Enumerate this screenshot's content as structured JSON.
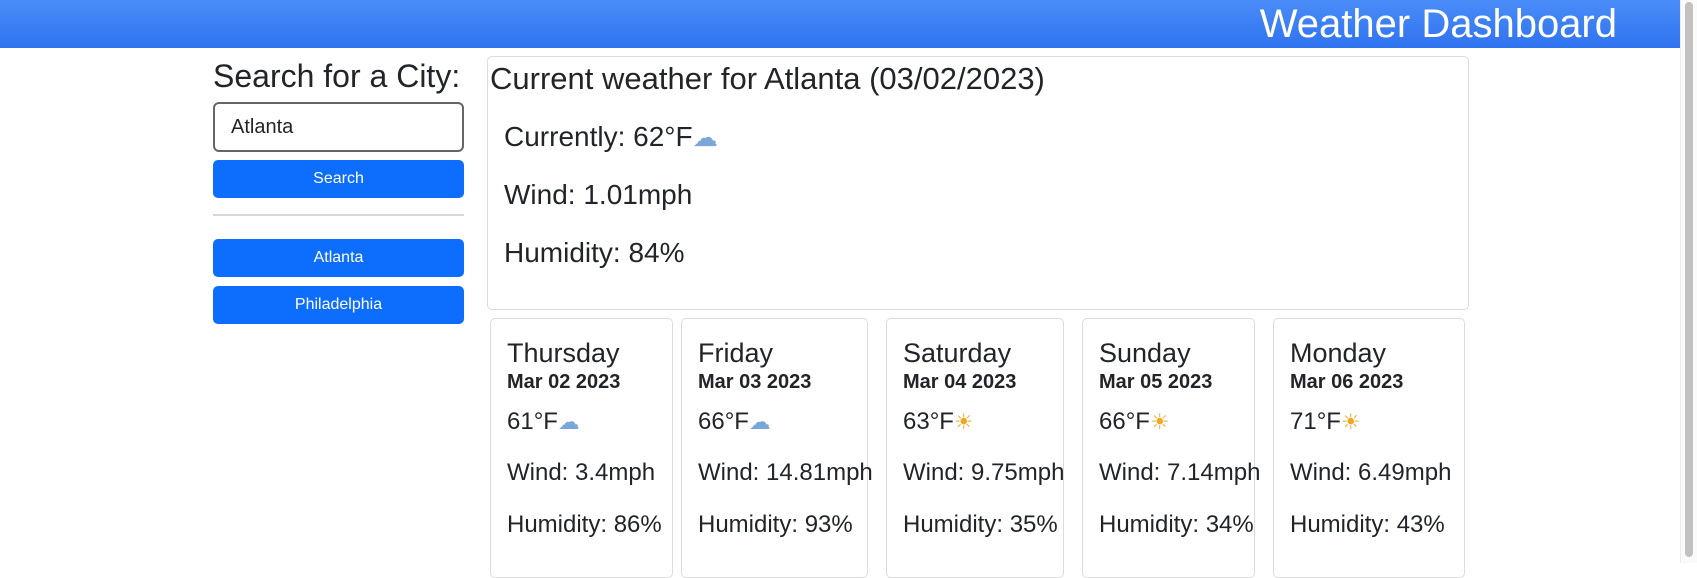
{
  "header": {
    "title": "Weather Dashboard"
  },
  "sidebar": {
    "heading": "Search for a City:",
    "search_value": "Atlanta",
    "search_button": "Search",
    "history": [
      "Atlanta",
      "Philadelphia"
    ]
  },
  "current": {
    "title": "Current weather for Atlanta (03/02/2023)",
    "temp": "Currently: 62°F",
    "temp_icon": "rain-cloud-icon",
    "wind": "Wind: 1.01mph",
    "humidity": "Humidity: 84%"
  },
  "forecast": [
    {
      "day": "Thursday",
      "date": "Mar 02 2023",
      "temp": "61°F",
      "icon": "rain-cloud-icon",
      "wind": "Wind: 3.4mph",
      "humidity": "Humidity: 86%"
    },
    {
      "day": "Friday",
      "date": "Mar 03 2023",
      "temp": "66°F",
      "icon": "rain-cloud-icon",
      "wind": "Wind: 14.81mph",
      "humidity": "Humidity: 93%"
    },
    {
      "day": "Saturday",
      "date": "Mar 04 2023",
      "temp": "63°F",
      "icon": "sun-icon",
      "wind": "Wind: 9.75mph",
      "humidity": "Humidity: 35%"
    },
    {
      "day": "Sunday",
      "date": "Mar 05 2023",
      "temp": "66°F",
      "icon": "sun-icon",
      "wind": "Wind: 7.14mph",
      "humidity": "Humidity: 34%"
    },
    {
      "day": "Monday",
      "date": "Mar 06 2023",
      "temp": "71°F",
      "icon": "sun-icon",
      "wind": "Wind: 6.49mph",
      "humidity": "Humidity: 43%"
    }
  ],
  "colors": {
    "header": "#3b82f6",
    "button": "#0d6efd",
    "text": "#212529"
  }
}
